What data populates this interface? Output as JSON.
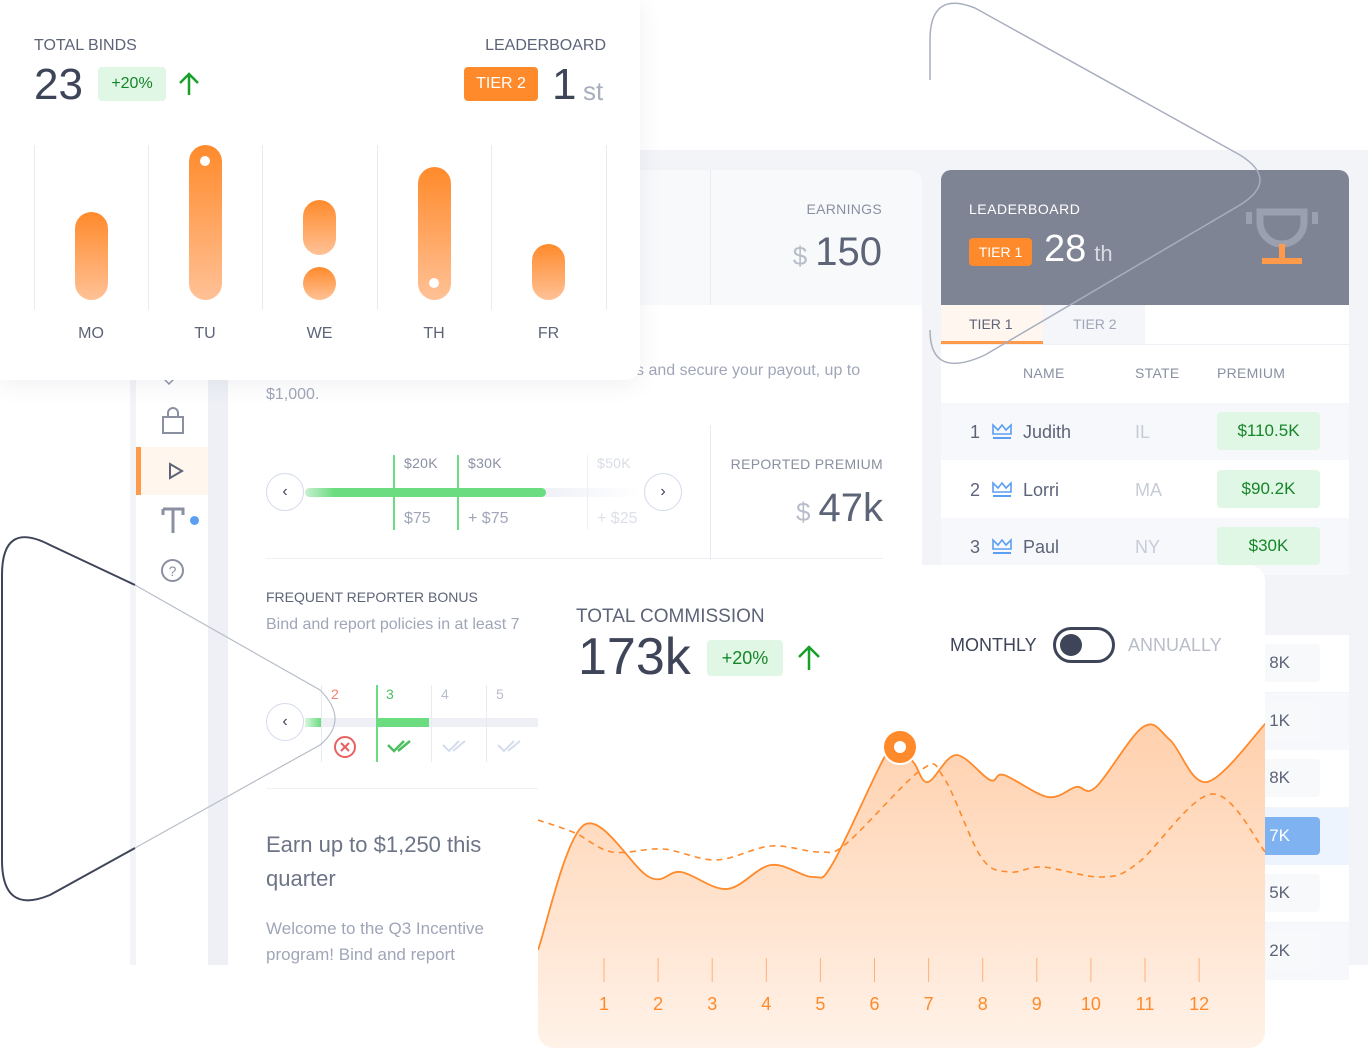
{
  "binds_card": {
    "title": "TOTAL BINDS",
    "value": "23",
    "change": "+20%",
    "leaderboard_label": "LEADERBOARD",
    "tier": "TIER 2",
    "rank": "1",
    "rank_suffix": "st",
    "days": [
      "MO",
      "TU",
      "WE",
      "TH",
      "FR"
    ]
  },
  "earnings": {
    "label": "EARNINGS",
    "currency": "$",
    "value": "150"
  },
  "incentive": {
    "desc_tail": "s and secure your payout, up to",
    "desc_end": "$1,000.",
    "thresholds": [
      "$20K",
      "$30K",
      "$50K"
    ],
    "rewards": [
      "$75",
      "+ $75",
      "+ $25"
    ],
    "reported_premium_label": "REPORTED PREMIUM",
    "reported_premium_currency": "$",
    "reported_premium": "47k",
    "progress_percent": 72
  },
  "frequent": {
    "title": "FREQUENT REPORTER BONUS",
    "desc": "Bind and report policies in at least 7",
    "steps": [
      "2",
      "3",
      "4",
      "5"
    ],
    "step_status": [
      "missed",
      "done",
      "pending",
      "pending"
    ]
  },
  "promo": {
    "heading": "Earn up to $1,250 this quarter",
    "body": "Welcome to the Q3 Incentive program! Bind and report"
  },
  "leaderboard": {
    "label": "LEADERBOARD",
    "tier": "TIER 1",
    "rank": "28",
    "rank_suffix": "th",
    "tabs": [
      "TIER 1",
      "TIER 2"
    ],
    "active_tab": "TIER 1",
    "columns": [
      "NAME",
      "STATE",
      "PREMIUM"
    ],
    "rows": [
      {
        "rank": "1",
        "name": "Judith",
        "state": "IL",
        "premium": "$110.5K"
      },
      {
        "rank": "2",
        "name": "Lorri",
        "state": "MA",
        "premium": "$90.2K"
      },
      {
        "rank": "3",
        "name": "Paul",
        "state": "NY",
        "premium": "$30K"
      }
    ],
    "hidden_rows": [
      "8K",
      "1K",
      "8K",
      "7K",
      "5K",
      "2K"
    ],
    "highlighted_hidden_row": 3
  },
  "commission": {
    "title": "TOTAL COMMISSION",
    "value": "173k",
    "change": "+20%",
    "toggle_left": "MONTHLY",
    "toggle_right": "ANNUALLY",
    "toggle_state": "MONTHLY"
  },
  "chart_data": {
    "type": "area",
    "categories": [
      "1",
      "2",
      "3",
      "4",
      "5",
      "6",
      "7",
      "8",
      "9",
      "10",
      "11",
      "12"
    ],
    "series": [
      {
        "style": "solid-filled"
      },
      {
        "style": "dashed"
      }
    ],
    "grid": false
  },
  "colors": {
    "accent": "#ff8a2b",
    "positive": "#17852a",
    "positive_bg": "#dff7e4",
    "highlight": "#7fb2f0",
    "header": "#7f8494"
  }
}
